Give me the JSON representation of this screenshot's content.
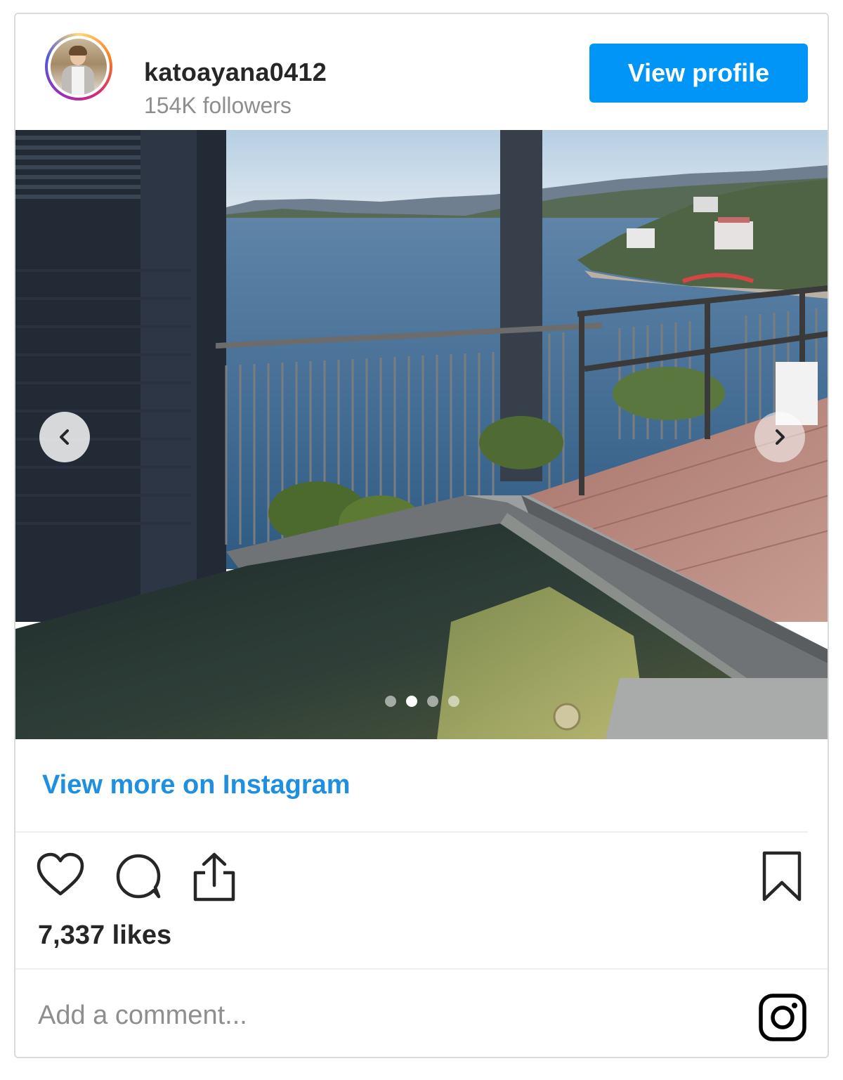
{
  "header": {
    "username": "katoayana0412",
    "followers": "154K followers",
    "view_profile_label": "View profile"
  },
  "post": {
    "photo_alt": "",
    "carousel_total": 4,
    "carousel_active": 2,
    "view_more_label": "View more on Instagram",
    "likes": "7,337 likes"
  },
  "comment": {
    "placeholder": "Add a comment..."
  },
  "colors": {
    "accent": "#0095f6",
    "link": "#1e8fe1",
    "text": "#262626",
    "muted": "#8e8e8e",
    "border": "#dbdbdb"
  },
  "icons": {
    "prev": "chevron-left-icon",
    "next": "chevron-right-icon",
    "like": "heart-icon",
    "comment": "speech-bubble-icon",
    "share": "share-icon",
    "save": "bookmark-icon",
    "brand": "instagram-logo-icon"
  }
}
